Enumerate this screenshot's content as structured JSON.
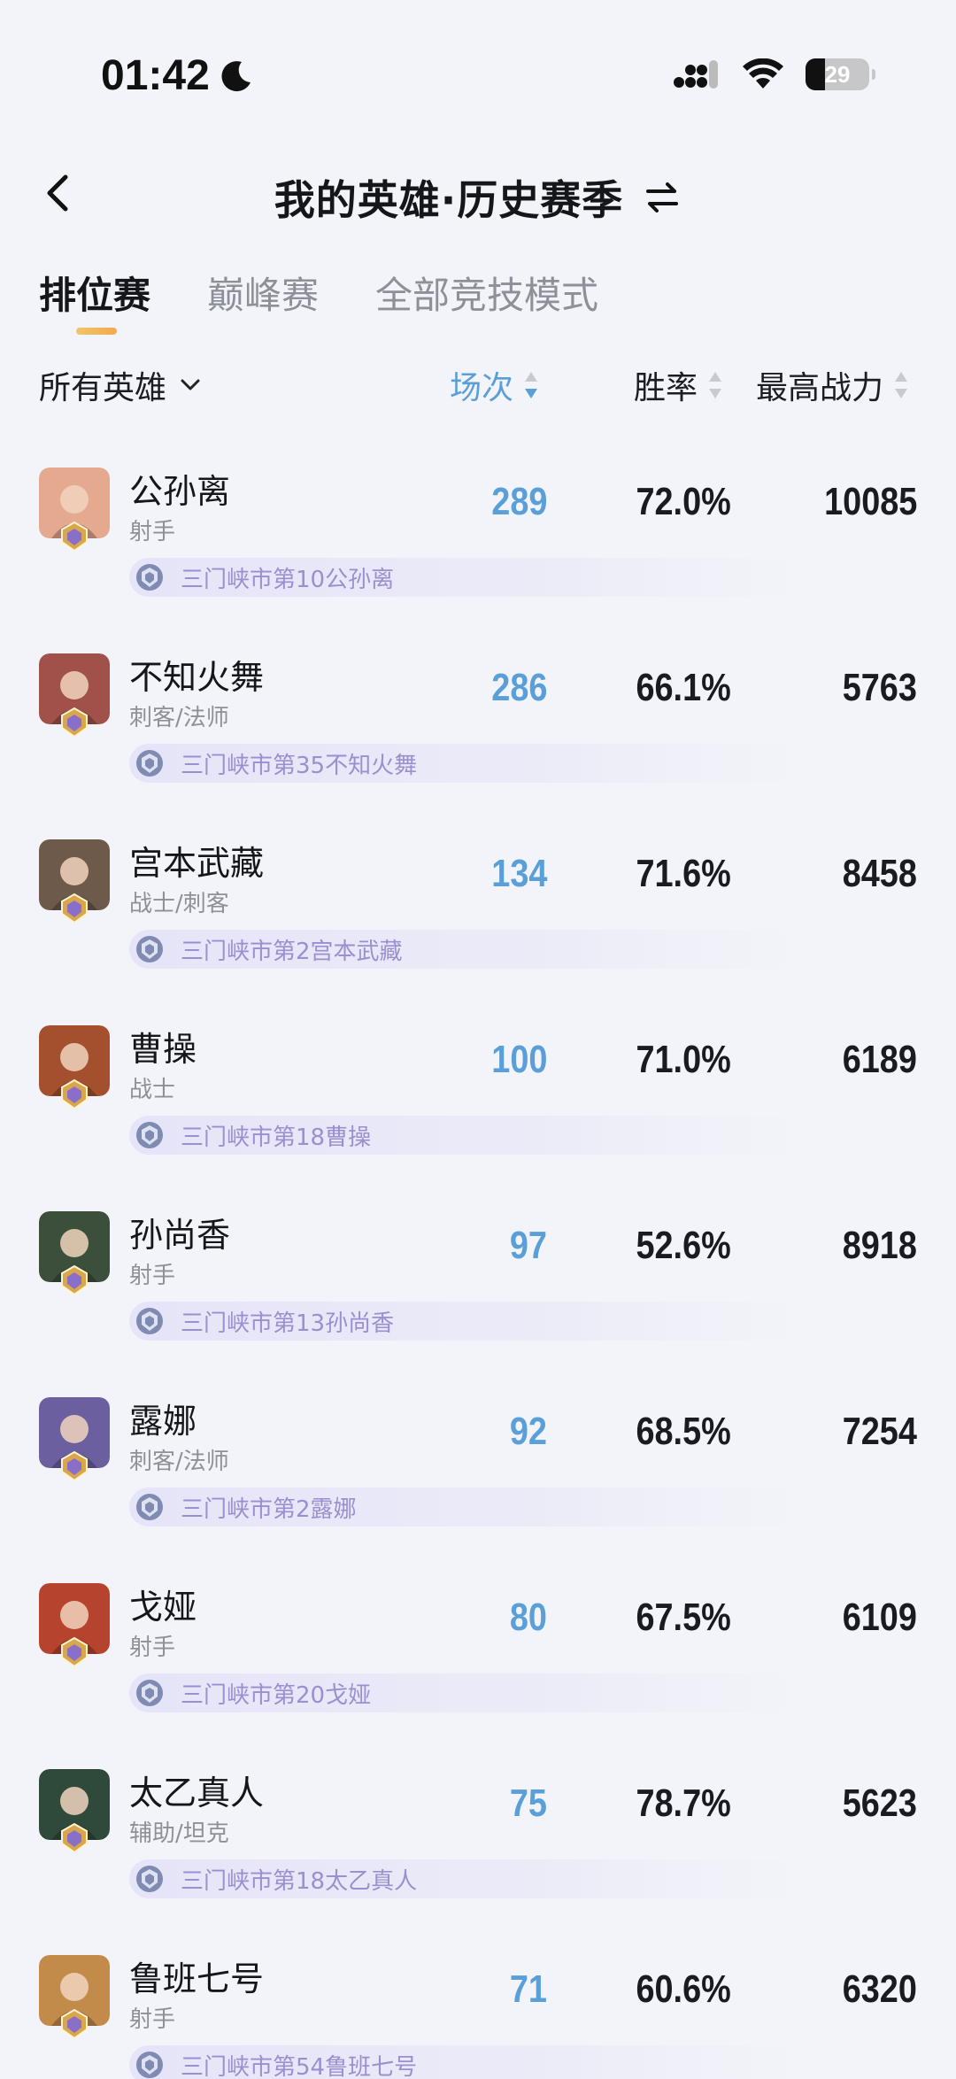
{
  "status_bar": {
    "time": "01:42",
    "battery": "29"
  },
  "nav": {
    "title": "我的英雄·历史赛季"
  },
  "tabs": [
    {
      "label": "排位赛",
      "active": true
    },
    {
      "label": "巅峰赛",
      "active": false
    },
    {
      "label": "全部竞技模式",
      "active": false
    }
  ],
  "filters": {
    "hero_filter": "所有英雄",
    "col_games": "场次",
    "col_winrate": "胜率",
    "col_power": "最高战力",
    "active_sort": "场次"
  },
  "heroes": [
    {
      "name": "公孙离",
      "role": "射手",
      "games": "289",
      "winrate": "72.0%",
      "power": "10085",
      "title": "三门峡市第10公孙离",
      "color": "#e4a98f"
    },
    {
      "name": "不知火舞",
      "role": "刺客/法师",
      "games": "286",
      "winrate": "66.1%",
      "power": "5763",
      "title": "三门峡市第35不知火舞",
      "color": "#a0524a"
    },
    {
      "name": "宫本武藏",
      "role": "战士/刺客",
      "games": "134",
      "winrate": "71.6%",
      "power": "8458",
      "title": "三门峡市第2宫本武藏",
      "color": "#6d5a4a"
    },
    {
      "name": "曹操",
      "role": "战士",
      "games": "100",
      "winrate": "71.0%",
      "power": "6189",
      "title": "三门峡市第18曹操",
      "color": "#a4502e"
    },
    {
      "name": "孙尚香",
      "role": "射手",
      "games": "97",
      "winrate": "52.6%",
      "power": "8918",
      "title": "三门峡市第13孙尚香",
      "color": "#3b4f3a"
    },
    {
      "name": "露娜",
      "role": "刺客/法师",
      "games": "92",
      "winrate": "68.5%",
      "power": "7254",
      "title": "三门峡市第2露娜",
      "color": "#6b5fa0"
    },
    {
      "name": "戈娅",
      "role": "射手",
      "games": "80",
      "winrate": "67.5%",
      "power": "6109",
      "title": "三门峡市第20戈娅",
      "color": "#b5432e"
    },
    {
      "name": "太乙真人",
      "role": "辅助/坦克",
      "games": "75",
      "winrate": "78.7%",
      "power": "5623",
      "title": "三门峡市第18太乙真人",
      "color": "#2f4a3a"
    },
    {
      "name": "鲁班七号",
      "role": "射手",
      "games": "71",
      "winrate": "60.6%",
      "power": "6320",
      "title": "三门峡市第54鲁班七号",
      "color": "#c28b4a"
    }
  ]
}
